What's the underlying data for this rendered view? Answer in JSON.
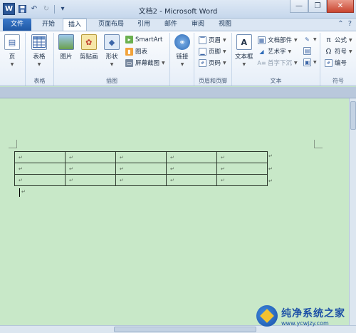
{
  "window": {
    "title": "文档2 - Microsoft Word"
  },
  "qat": {
    "logo": "W",
    "save_icon": "save-icon",
    "undo_icon": "undo-icon",
    "redo_icon": "redo-icon"
  },
  "tabs": [
    "文件",
    "开始",
    "插入",
    "页面布局",
    "引用",
    "邮件",
    "审阅",
    "视图"
  ],
  "active_tab": "插入",
  "ribbon": {
    "pages_group": {
      "page_label": "页"
    },
    "table_group": {
      "label": "表格",
      "button": "表格"
    },
    "illustrations_group": {
      "label": "插图",
      "picture": "图片",
      "clipart": "剪贴画",
      "shapes": "形状",
      "smartart": "SmartArt",
      "chart": "图表",
      "screenshot": "屏幕截图"
    },
    "links_group": {
      "link": "链接"
    },
    "header_footer_group": {
      "label": "页眉和页脚",
      "header": "页眉",
      "footer": "页脚",
      "page_number": "页码"
    },
    "text_group": {
      "label": "文本",
      "textbox": "文本框",
      "quickparts": "文档部件",
      "wordart": "艺术字",
      "dropcap": "首字下沉"
    },
    "symbols_group": {
      "label": "符号",
      "equation": "公式",
      "symbol": "符号",
      "number": "编号"
    }
  },
  "document": {
    "table": {
      "rows": 3,
      "cols": 5,
      "cell_mark": "↵"
    },
    "end_mark": "↵"
  },
  "watermark": {
    "main": "纯净系统之家",
    "sub": "www.ycwjzy.com"
  },
  "colors": {
    "doc_background": "#c8e8c8",
    "file_tab": "#2b5797"
  }
}
